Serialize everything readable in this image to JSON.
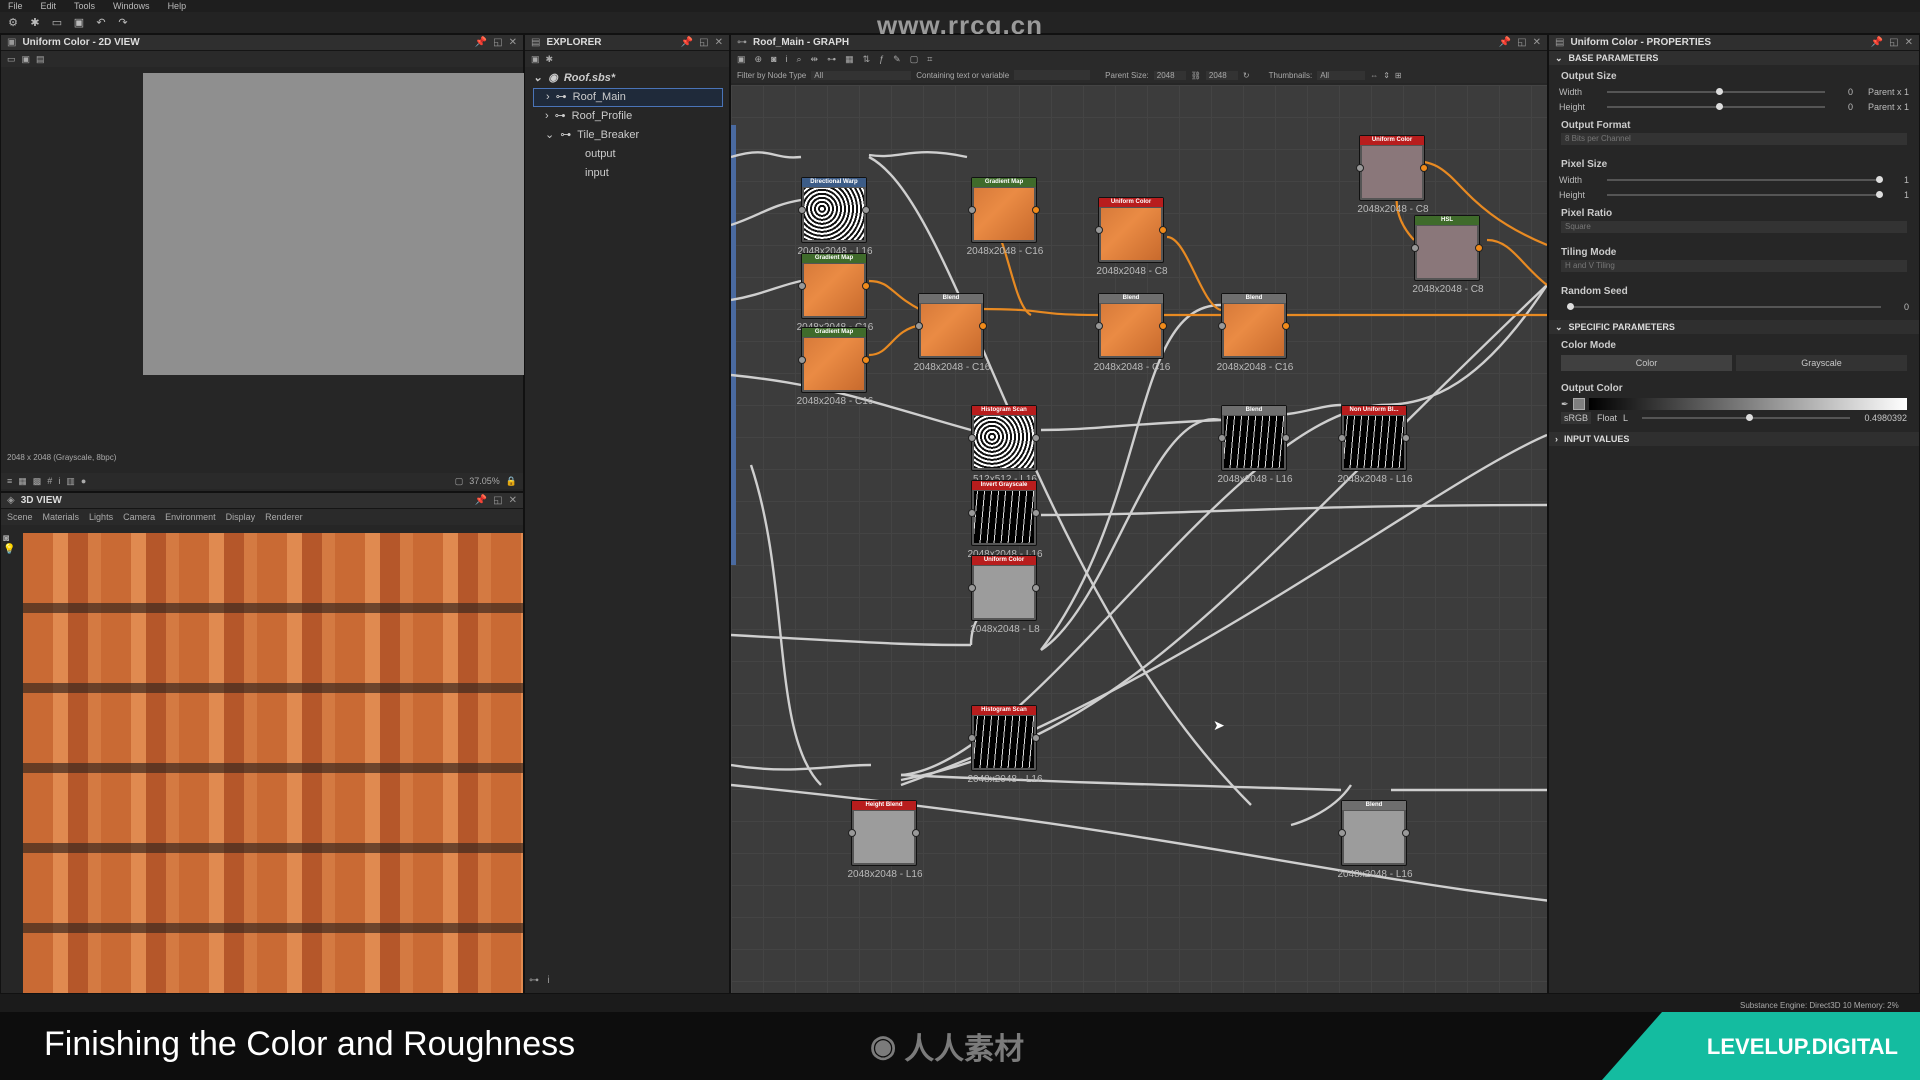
{
  "watermark": "www.rrcg.cn",
  "menu": [
    "File",
    "Edit",
    "Tools",
    "Windows",
    "Help"
  ],
  "view2d": {
    "title": "Uniform Color - 2D VIEW",
    "status": "2048 x 2048 (Grayscale, 8bpc)",
    "zoom": "37.05%"
  },
  "view3d": {
    "title": "3D VIEW",
    "menu": [
      "Scene",
      "Materials",
      "Lights",
      "Camera",
      "Environment",
      "Display",
      "Renderer"
    ]
  },
  "explorer": {
    "title": "EXPLORER",
    "package": "Roof.sbs*",
    "items": [
      "Roof_Main",
      "Roof_Profile",
      "Tile_Breaker"
    ],
    "subitems": [
      "output",
      "input"
    ]
  },
  "graph": {
    "title": "Roof_Main - GRAPH",
    "filter_label": "Filter by Node Type",
    "filter_value": "All",
    "containing_label": "Containing text or variable",
    "parent_size_label": "Parent Size:",
    "parent_size_value": "2048",
    "parent_size_value2": "2048",
    "thumbnails_label": "Thumbnails:",
    "thumbnails_value": "All",
    "nodes": [
      {
        "name": "Directional Warp",
        "label": "2048x2048 - L16",
        "hdr": "blue"
      },
      {
        "name": "Gradient Map",
        "label": "2048x2048 - C16",
        "hdr": "green"
      },
      {
        "name": "Uniform Color",
        "label": "2048x2048 - C8",
        "hdr": "red"
      },
      {
        "name": "Uniform Color",
        "label": "2048x2048 - C8",
        "hdr": "red"
      },
      {
        "name": "HSL",
        "label": "2048x2048 - C8",
        "hdr": "green"
      },
      {
        "name": "Gradient Map",
        "label": "2048x2048 - C16",
        "hdr": "green"
      },
      {
        "name": "Blend",
        "label": "2048x2048 - C16",
        "hdr": "gray"
      },
      {
        "name": "Blend",
        "label": "2048x2048 - C16",
        "hdr": "gray"
      },
      {
        "name": "Blend",
        "label": "2048x2048 - C16",
        "hdr": "gray"
      },
      {
        "name": "Gradient Map",
        "label": "2048x2048 - C16",
        "hdr": "green"
      },
      {
        "name": "Histogram Scan",
        "label": "512x512 - L16",
        "hdr": "red"
      },
      {
        "name": "Blend",
        "label": "2048x2048 - L16",
        "hdr": "gray"
      },
      {
        "name": "Non Uniform Bl...",
        "label": "2048x2048 - L16",
        "hdr": "red"
      },
      {
        "name": "Invert Grayscale",
        "label": "2048x2048 - L16",
        "hdr": "red"
      },
      {
        "name": "Uniform Color",
        "label": "2048x2048 - L8",
        "hdr": "red"
      },
      {
        "name": "Histogram Scan",
        "label": "2048x2048 - L16",
        "hdr": "red"
      },
      {
        "name": "Height Blend",
        "label": "2048x2048 - L16",
        "hdr": "red"
      },
      {
        "name": "Blend",
        "label": "2048x2048 - L16",
        "hdr": "gray"
      }
    ]
  },
  "properties": {
    "title": "Uniform Color - PROPERTIES",
    "base_header": "BASE PARAMETERS",
    "output_size": "Output Size",
    "width": "Width",
    "height": "Height",
    "size_val": "0",
    "parent_x1": "Parent x 1",
    "output_format": "Output Format",
    "output_format_value": "8 Bits per Channel",
    "pixel_size": "Pixel Size",
    "pixel_val": "1",
    "pixel_ratio": "Pixel Ratio",
    "pixel_ratio_value": "Square",
    "tiling_mode": "Tiling Mode",
    "tiling_value": "H and V Tiling",
    "random_seed": "Random Seed",
    "seed_val": "0",
    "specific_header": "SPECIFIC PARAMETERS",
    "color_mode": "Color Mode",
    "mode_color": "Color",
    "mode_gray": "Grayscale",
    "output_color": "Output Color",
    "srgb": "sRGB",
    "float": "Float",
    "l": "L",
    "color_value": "0.4980392",
    "color_level": 0.498,
    "input_header": "INPUT VALUES"
  },
  "status_bar": "Substance Engine: Direct3D 10  Memory: 2%",
  "bottom": {
    "title": "Finishing the Color and Roughness",
    "logo_text": "人人素材",
    "brand": "LEVELUP.DIGITAL"
  },
  "colors": {
    "accent": "#f08a1a",
    "brand": "#14bca0"
  }
}
